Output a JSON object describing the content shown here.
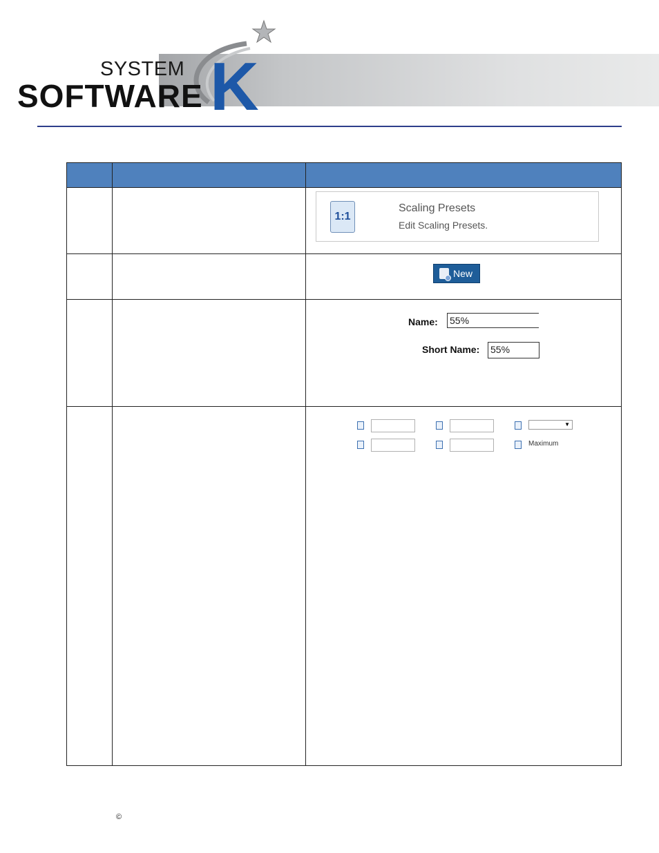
{
  "logo": {
    "line1": "SYSTEM",
    "line2": "SOFTWARE",
    "letter": "K"
  },
  "rows": {
    "scaling_presets": {
      "icon_text": "1:1",
      "title": "Scaling Presets",
      "description": "Edit Scaling Presets."
    },
    "new_button": {
      "label": "New"
    },
    "name_fields": {
      "name_label": "Name:",
      "name_value": "55%",
      "short_name_label": "Short Name:",
      "short_name_value": "55%"
    },
    "scale_options": {
      "select_arrow": "▼",
      "maximum_label": "Maximum"
    }
  },
  "footer": {
    "copyright": "©"
  },
  "colors": {
    "header_row": "#4f81bd",
    "button": "#1e5d99",
    "logo_k": "#1d58a8",
    "divider": "#2d3e8a"
  }
}
